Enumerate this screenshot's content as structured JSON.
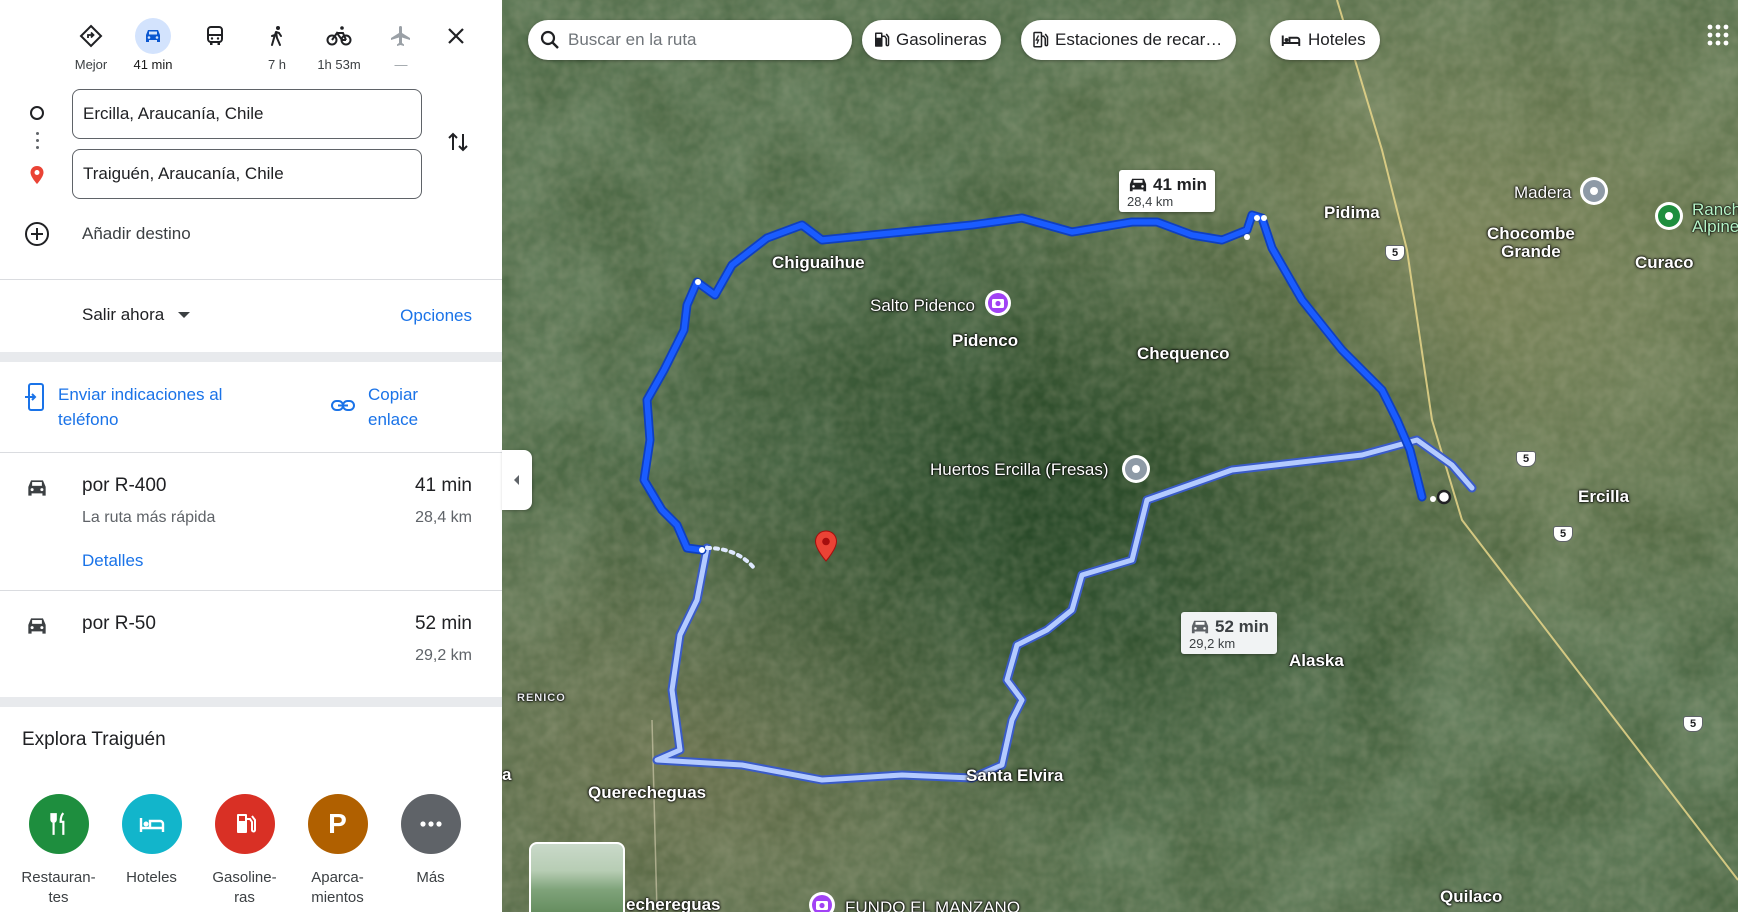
{
  "modes": [
    {
      "label": "Mejor",
      "icon": "diamond-turn-icon",
      "active": false
    },
    {
      "label": "41 min",
      "icon": "car-icon",
      "active": true
    },
    {
      "label": "",
      "icon": "bus-icon",
      "active": false
    },
    {
      "label": "7 h",
      "icon": "walk-icon",
      "active": false
    },
    {
      "label": "1h 53m",
      "icon": "bicycle-icon",
      "active": false
    },
    {
      "label": "—",
      "icon": "airplane-icon",
      "active": false
    }
  ],
  "waypoints": {
    "origin": "Ercilla, Araucanía, Chile",
    "destination": "Traiguén, Araucanía, Chile",
    "add_destination": "Añadir destino"
  },
  "depart": {
    "label": "Salir ahora",
    "options": "Opciones"
  },
  "share": {
    "send_phone": "Enviar indicaciones al teléfono",
    "copy_link": "Copiar enlace"
  },
  "routes": [
    {
      "name": "por R-400",
      "subtitle": "La ruta más rápida",
      "time": "41 min",
      "distance": "28,4 km",
      "details": "Detalles"
    },
    {
      "name": "por R-50",
      "time": "52 min",
      "distance": "29,2 km"
    }
  ],
  "explore": {
    "title": "Explora Traiguén",
    "categories": [
      {
        "label": "Restauran-\ntes",
        "icon": "restaurant-icon",
        "color": "#1e8e3e"
      },
      {
        "label": "Hoteles",
        "icon": "hotel-icon",
        "color": "#12b5cb"
      },
      {
        "label": "Gasoline-\nras",
        "icon": "gas-station-icon",
        "color": "#d93025"
      },
      {
        "label": "Aparca-\nmientos",
        "icon": "parking-icon",
        "color": "#b06000"
      },
      {
        "label": "Más",
        "icon": "more-icon",
        "color": "#5f6368"
      }
    ]
  },
  "map_top": {
    "search_placeholder": "Buscar en la ruta",
    "chips": [
      "Gasolineras",
      "Estaciones de recar…",
      "Hoteles"
    ]
  },
  "map_labels": {
    "chiguaihue": "Chiguaihue",
    "salto_pidenco": "Salto Pidenco",
    "pidenco": "Pidenco",
    "chequenco": "Chequenco",
    "pidima": "Pidima",
    "madera": "Madera",
    "chocombe": "Chocombe\nGrande",
    "curaco": "Curaco",
    "rancho": "Ranch\nAlpine",
    "huertos": "Huertos Ercilla (Fresas)",
    "ercilla": "Ercilla",
    "alaska": "Alaska",
    "renico": "RENICO",
    "querecheguas": "Querecheguas",
    "santa_elvira": "Santa Elvira",
    "quilaco": "Quilaco",
    "fundo": "FUNDO EL MANZANO",
    "echereguas": "echereguas",
    "a": "a"
  },
  "route_boxes": {
    "main": {
      "time": "41 min",
      "distance": "28,4 km"
    },
    "alt": {
      "time": "52 min",
      "distance": "29,2 km"
    }
  },
  "shields": [
    "5",
    "5",
    "5",
    "5"
  ],
  "colors": {
    "accent": "#1a73e8",
    "route": "#1a5cff",
    "alt_route": "#a7c1ff",
    "pin": "#ea4335"
  }
}
